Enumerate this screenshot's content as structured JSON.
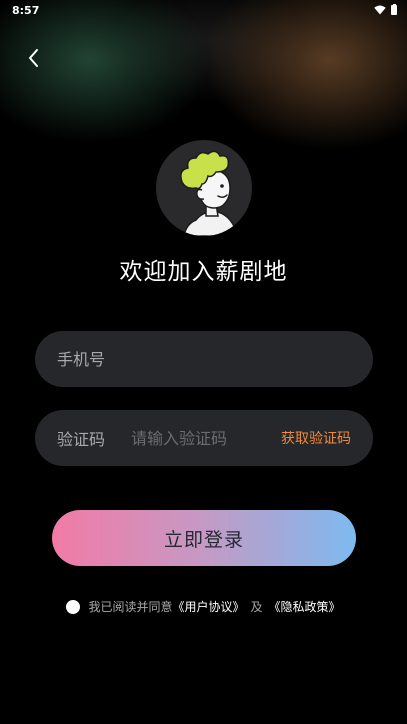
{
  "status_bar": {
    "time": "8:57"
  },
  "header": {
    "back_icon": "chevron-left-icon"
  },
  "avatar": {
    "icon": "cartoon-avatar-icon",
    "colors": {
      "background": "#2a2a2c",
      "hair": "#c8e04a"
    }
  },
  "welcome": {
    "title": "欢迎加入薪剧地"
  },
  "phone": {
    "placeholder": "手机号",
    "value": ""
  },
  "code": {
    "label": "验证码",
    "placeholder": "请输入验证码",
    "value": "",
    "get_code_label": "获取验证码"
  },
  "login": {
    "label": "立即登录",
    "gradient": [
      "#f27aa6",
      "#c49ac4",
      "#7dbaf0"
    ]
  },
  "agreement": {
    "checked": false,
    "prefix": "我已阅读并同意",
    "user_agreement": "《用户协议》",
    "and": "及",
    "privacy_policy": "《隐私政策》"
  },
  "colors": {
    "background": "#000000",
    "field_background": "#26272b",
    "accent_orange": "#f08a3a"
  }
}
